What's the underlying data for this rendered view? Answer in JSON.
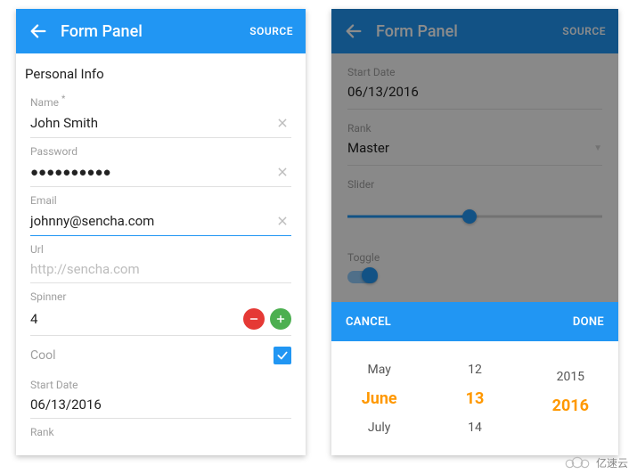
{
  "header": {
    "title": "Form Panel",
    "source_label": "SOURCE"
  },
  "section_heading": "Personal Info",
  "fields": {
    "name": {
      "label": "Name",
      "required_mark": "*",
      "value": "John Smith"
    },
    "password": {
      "label": "Password",
      "value": "●●●●●●●●●●"
    },
    "email": {
      "label": "Email",
      "value": "johnny@sencha.com"
    },
    "url": {
      "label": "Url",
      "placeholder": "http://sencha.com",
      "value": ""
    },
    "spinner": {
      "label": "Spinner",
      "value": "4"
    },
    "cool": {
      "label": "Cool",
      "checked": true
    },
    "startdate": {
      "label": "Start Date",
      "value": "06/13/2016"
    },
    "rank": {
      "label": "Rank",
      "value": "Master"
    },
    "slider": {
      "label": "Slider",
      "percent": 48
    },
    "toggle": {
      "label": "Toggle",
      "on": true
    }
  },
  "picker": {
    "actions": {
      "cancel": "CANCEL",
      "done": "DONE"
    },
    "month": {
      "prev": "May",
      "sel": "June",
      "next": "July"
    },
    "day": {
      "prev": "12",
      "sel": "13",
      "next": "14"
    },
    "year": {
      "prev": "2015",
      "sel": "2016",
      "next": ""
    }
  },
  "watermark": "亿速云"
}
